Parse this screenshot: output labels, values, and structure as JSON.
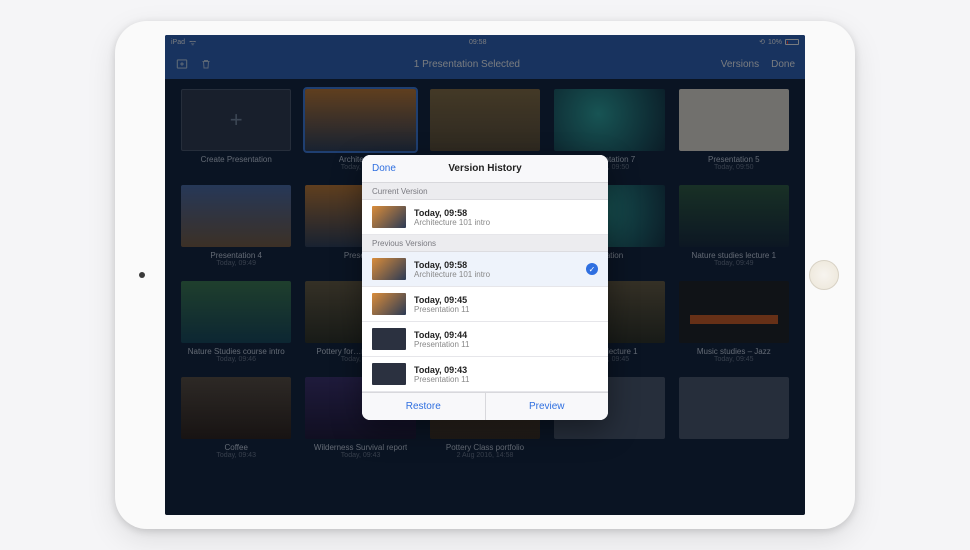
{
  "status": {
    "carrier": "iPad",
    "time": "09:58",
    "battery_pct": "10%"
  },
  "nav": {
    "title": "1 Presentation Selected",
    "versions": "Versions",
    "done": "Done"
  },
  "grid": [
    {
      "title": "Create Presentation",
      "sub": "",
      "create": true
    },
    {
      "title": "Architectu…",
      "sub": "Today, 09:58",
      "cls": "ti-arch",
      "selected": true
    },
    {
      "title": "",
      "sub": "",
      "cls": "ti-hat"
    },
    {
      "title": "Presentation 7",
      "sub": "Today, 09:50",
      "cls": "ti-abstract"
    },
    {
      "title": "Presentation 5",
      "sub": "Today, 09:50",
      "cls": "ti-invite"
    },
    {
      "title": "Presentation 4",
      "sub": "Today, 09:49",
      "cls": "ti-colosseum"
    },
    {
      "title": "Presen…",
      "sub": "",
      "cls": "ti-arch"
    },
    {
      "title": "",
      "sub": "",
      "cls": "ti-redblack"
    },
    {
      "title": "…tation",
      "sub": "",
      "cls": "ti-abstract"
    },
    {
      "title": "Nature studies lecture 1",
      "sub": "Today, 09:49",
      "cls": "ti-nature"
    },
    {
      "title": "Nature Studies course intro",
      "sub": "Today, 09:46",
      "cls": "ti-nature2"
    },
    {
      "title": "Pottery for…ming lecture",
      "sub": "Today, 09:46",
      "cls": "ti-pottery"
    },
    {
      "title": "",
      "sub": "",
      "cls": "ti-redblack"
    },
    {
      "title": "…ners lecture 1",
      "sub": "Today, 09:45",
      "cls": "ti-pottery"
    },
    {
      "title": "Music studies – Jazz",
      "sub": "Today, 09:45",
      "cls": "ti-jazz"
    },
    {
      "title": "Coffee",
      "sub": "Today, 09:43",
      "cls": "ti-coffee"
    },
    {
      "title": "Wilderness Survival report",
      "sub": "Today, 09:43",
      "cls": "ti-wilderness"
    },
    {
      "title": "Pottery Class portfolio",
      "sub": "2 Aug 2016, 14:58",
      "cls": "ti-potteryclass"
    },
    {
      "title": "",
      "sub": "",
      "cls": ""
    },
    {
      "title": "",
      "sub": "",
      "cls": ""
    }
  ],
  "popover": {
    "done": "Done",
    "title": "Version History",
    "current_label": "Current Version",
    "previous_label": "Previous Versions",
    "current": {
      "time": "Today, 09:58",
      "name": "Architecture 101 intro",
      "thumb": "arch"
    },
    "previous": [
      {
        "time": "Today, 09:58",
        "name": "Architecture 101 intro",
        "thumb": "arch",
        "selected": true
      },
      {
        "time": "Today, 09:45",
        "name": "Presentation 11",
        "thumb": "arch"
      },
      {
        "time": "Today, 09:44",
        "name": "Presentation 11",
        "thumb": "dark"
      },
      {
        "time": "Today, 09:43",
        "name": "Presentation 11",
        "thumb": "dark"
      }
    ],
    "restore": "Restore",
    "preview": "Preview"
  }
}
